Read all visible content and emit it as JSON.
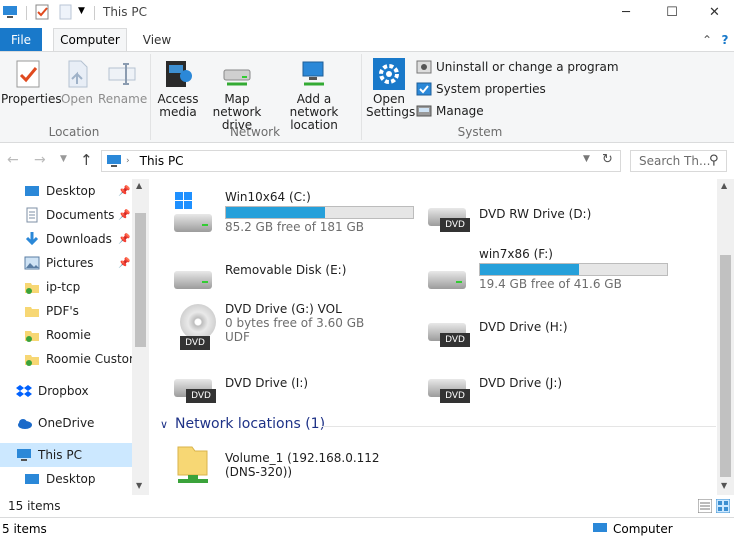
{
  "window": {
    "title": "This PC",
    "minimize_glyph": "─",
    "maximize_glyph": "☐",
    "close_glyph": "✕"
  },
  "tabs": {
    "file": "File",
    "computer": "Computer",
    "view": "View",
    "collapse_glyph": "⌃",
    "help_glyph": "?"
  },
  "ribbon": {
    "location": {
      "label": "Location",
      "properties": "Properties",
      "open": "Open",
      "rename": "Rename"
    },
    "network": {
      "label": "Network",
      "access_media": "Access media",
      "map_network_drive": "Map network drive",
      "add_network_location": "Add a network location"
    },
    "system": {
      "label": "System",
      "open_settings": "Open Settings",
      "uninstall": "Uninstall or change a program",
      "system_properties": "System properties",
      "manage": "Manage"
    }
  },
  "address": {
    "path": "This PC",
    "search_placeholder": "Search Th..."
  },
  "nav": {
    "items": [
      {
        "label": "Desktop",
        "pinned": true
      },
      {
        "label": "Documents",
        "pinned": true
      },
      {
        "label": "Downloads",
        "pinned": true
      },
      {
        "label": "Pictures",
        "pinned": true
      },
      {
        "label": "ip-tcp",
        "pinned": false
      },
      {
        "label": "PDF's",
        "pinned": false
      },
      {
        "label": "Roomie",
        "pinned": false
      },
      {
        "label": "Roomie Custom",
        "pinned": false
      },
      {
        "label": "Dropbox",
        "pinned": false
      },
      {
        "label": "OneDrive",
        "pinned": false
      },
      {
        "label": "This PC",
        "pinned": false
      },
      {
        "label": "Desktop",
        "pinned": false
      }
    ]
  },
  "drives": [
    {
      "name": "Win10x64 (C:)",
      "free": "85.2 GB free of 181 GB",
      "used_fraction": 0.53,
      "type": "system-hdd"
    },
    {
      "name": "DVD RW Drive (D:)",
      "type": "dvd"
    },
    {
      "name": "Removable Disk (E:)",
      "type": "hdd"
    },
    {
      "name": "win7x86 (F:)",
      "free": "19.4 GB free of 41.6 GB",
      "used_fraction": 0.53,
      "type": "hdd"
    },
    {
      "name": "DVD Drive (G:) VOL",
      "line2": "0 bytes free of 3.60 GB",
      "line3": "UDF",
      "type": "dvd-disc"
    },
    {
      "name": "DVD Drive (H:)",
      "type": "dvd"
    },
    {
      "name": "DVD Drive (I:)",
      "type": "dvd"
    },
    {
      "name": "DVD Drive (J:)",
      "type": "dvd"
    }
  ],
  "network_locations": {
    "header": "Network locations (1)",
    "items": [
      {
        "line1": "Volume_1 (192.168.0.112",
        "line2": "(DNS-320))"
      }
    ]
  },
  "status": {
    "items_count": "15 items",
    "bottom_count": "5 items",
    "bottom_right": "Computer"
  },
  "colors": {
    "accent": "#1979ca",
    "bar_fill": "#26a0da"
  }
}
